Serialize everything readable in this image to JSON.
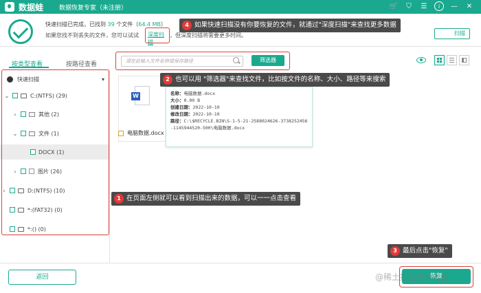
{
  "window": {
    "brand": "数据蛙",
    "subtitle": "数据恢复专家（未注册）",
    "icons": [
      "cart-icon",
      "shield-icon",
      "menu-icon",
      "info-icon",
      "minimize-icon",
      "close-icon"
    ]
  },
  "status": {
    "prefix": "快速扫描已完成，已找到 ",
    "count": "39",
    "middle": " 个文件（",
    "size": "64.4 MB",
    "suffix": "）",
    "line2": "如果您找不到丢失的文件，您可以试试",
    "deep_link": "深度扫描",
    "line3": "，但深度扫描将需要更多时间。",
    "deep_button": "扫描"
  },
  "left": {
    "tabs": [
      "按类型查看",
      "按路径查看"
    ],
    "tree": [
      {
        "label": "快速扫描",
        "type": "root"
      },
      {
        "label": "C:(NTFS) (29)",
        "type": "drive"
      },
      {
        "label": "其他 (2)",
        "type": "folder"
      },
      {
        "label": "文件 (1)",
        "type": "folder"
      },
      {
        "label": "DOCX (1)",
        "type": "leaf"
      },
      {
        "label": "图片 (26)",
        "type": "folder"
      },
      {
        "label": "D:(NTFS) (10)",
        "type": "drive"
      },
      {
        "label": "*:(FAT32) (0)",
        "type": "drive"
      },
      {
        "label": "*:() (0)",
        "type": "drive"
      }
    ]
  },
  "toolbar": {
    "search_placeholder": "请在此输入文件名称或保存路径",
    "filter_label": "筛选器"
  },
  "file": {
    "name": "电脑数据.docx",
    "icon_letter": "W"
  },
  "tooltip": {
    "name_label": "名称：",
    "name": "电脑数据.docx",
    "size_label": "大小：",
    "size": "0.00 B",
    "created_label": "创建日期：",
    "created": "2022-10-10",
    "modified_label": "修改日期：",
    "modified": "2022-10-10",
    "path_label": "路径：",
    "path": "C:\\$RECYCLE.BIN\\S-1-5-21-2588024626-3738252456-1145944520-500\\电脑数据.docx"
  },
  "annotations": [
    {
      "num": "1",
      "text": "在页面左侧就可以看到扫描出来的数据，可以一一点击查看"
    },
    {
      "num": "2",
      "text": "也可以用 \"筛选器\"来查找文件，比如按文件的名称、大小、路径等来搜索"
    },
    {
      "num": "3",
      "text": "最后点击\"恢复\""
    },
    {
      "num": "4",
      "text": "如果快速扫描没有你要恢复的文件，就通过\"深度扫描\"来查找更多数据"
    }
  ],
  "bottom": {
    "back_label": "返回",
    "recover_label": "恢复"
  },
  "watermark": "@稀土掘金技术社区",
  "colors": {
    "accent": "#1aa98e",
    "highlight": "#d9403b",
    "badge": "#e23a3a",
    "callout": "#4a4a4a"
  }
}
